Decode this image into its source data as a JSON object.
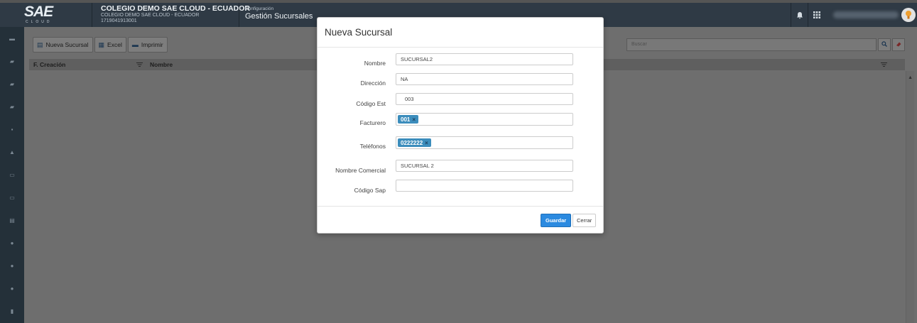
{
  "header": {
    "logo_text": "SAE",
    "logo_sub": "CLOUD",
    "school_name": "COLEGIO DEMO SAE CLOUD - ECUADOR",
    "school_subtitle": "COLEGIO DEMO SAE CLOUD - ECUADOR",
    "ruc": "1719041913001",
    "section_parent": "Configuración",
    "section_title": "Gestión Sucursales",
    "bell_icon": "bell-icon",
    "apps_icon": "apps-grid-icon"
  },
  "toolbar": {
    "new_label": "Nueva Sucursal",
    "excel_label": "Excel",
    "print_label": "Imprimir",
    "search_placeholder": "Buscar"
  },
  "grid": {
    "columns": [
      "F. Creación",
      "Nombre"
    ]
  },
  "modal": {
    "title": "Nueva Sucursal",
    "fields": {
      "nombre": {
        "label": "Nombre",
        "value": "SUCURSAL2"
      },
      "direccion": {
        "label": "Dirección",
        "value": "NA"
      },
      "codigo_est": {
        "label": "Código Est",
        "value": "003"
      },
      "facturero": {
        "label": "Facturero",
        "tags": [
          "001"
        ]
      },
      "telefonos": {
        "label": "Teléfonos",
        "tags": [
          "0222222"
        ]
      },
      "nombre_comercial": {
        "label": "Nombre Comercial",
        "value": "SUCURSAL 2"
      },
      "codigo_sap": {
        "label": "Código Sap",
        "value": ""
      }
    },
    "save_label": "Guardar",
    "close_label": "Cerrar"
  },
  "colors": {
    "primary": "#2b8ae0",
    "tag": "#3c8dbc",
    "topbar": "#2f3a45",
    "sidebar": "#243039"
  }
}
